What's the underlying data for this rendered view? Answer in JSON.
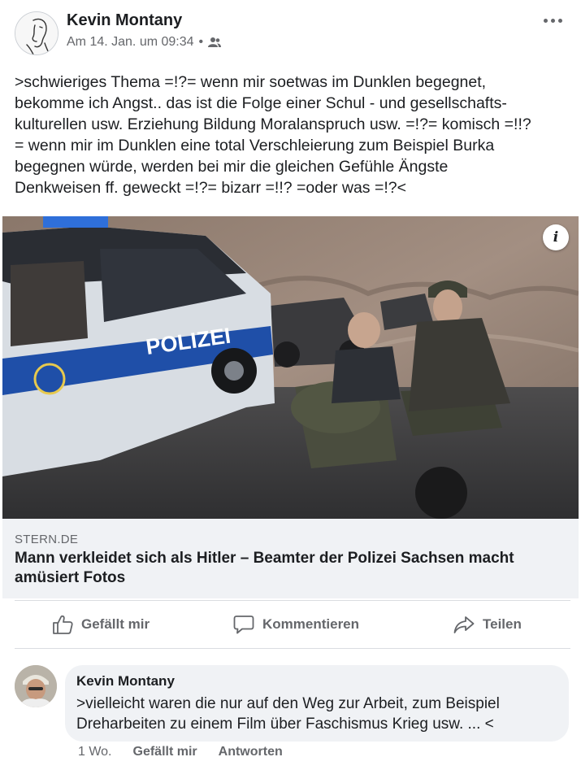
{
  "post": {
    "author": "Kevin Montany",
    "timestamp": "Am 14. Jan. um 09:34",
    "separator": "•",
    "audience_icon": "friends-icon",
    "text": ">schwieriges Thema =!?= wenn mir soetwas im Dunklen begegnet,\nbekomme ich Angst.. das ist die Folge einer Schul - und gesellschafts-\nkulturellen usw. Erziehung Bildung Moralanspruch usw. =!?= komisch =!!?\n= wenn mir im Dunklen eine total Verschleierung zum Beispiel Burka\nbegegnen würde, werden bei mir die gleichen Gefühle Ängste\nDenkweisen ff. geweckt =!?= bizarr =!!? =oder was =!?<"
  },
  "link_preview": {
    "image_text": "POLIZEI",
    "info_label": "i",
    "domain": "STERN.DE",
    "title": "Mann verkleidet sich als Hitler – Beamter der Polizei Sachsen macht amüsiert Fotos"
  },
  "actions": {
    "like": "Gefällt mir",
    "comment": "Kommentieren",
    "share": "Teilen"
  },
  "comment": {
    "author": "Kevin Montany",
    "text": ">vielleicht waren die nur auf den Weg zur Arbeit, zum Beispiel\nDreharbeiten zu einem Film über Faschismus Krieg usw. ... <",
    "age": "1 Wo.",
    "like": "Gefällt mir",
    "reply": "Antworten"
  },
  "colors": {
    "text": "#1c1e21",
    "secondary": "#65676b",
    "link_bg": "#f0f2f5",
    "police_blue": "#1f4fa8"
  }
}
